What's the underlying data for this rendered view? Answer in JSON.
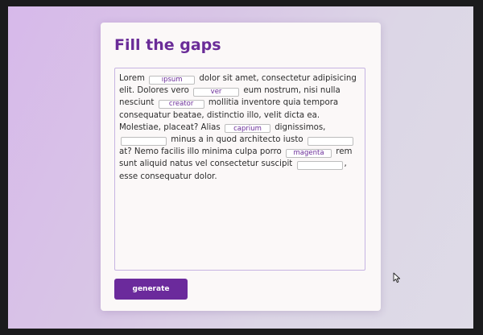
{
  "card": {
    "title": "Fill the gaps"
  },
  "passage": {
    "s1": "Lorem",
    "s2": "dolor sit amet, consectetur adipisicing elit. Dolores vero",
    "s3": "eum nostrum, nisi nulla nesciunt",
    "s4": "mollitia inventore quia tempora consequatur beatae, distinctio illo, velit dicta ea. Molestiae, placeat? Alias",
    "s5": "dignissimos,",
    "s6": "minus a in quod architecto iusto",
    "s7": "at? Nemo facilis illo minima culpa porro",
    "s8": "rem sunt aliquid natus vel consectetur suscipit",
    "s9": ", esse consequatur dolor."
  },
  "gaps": {
    "g1": "ipsum",
    "g2": "ver",
    "g3": "creator",
    "g4": "caprium",
    "g5": "",
    "g6": "",
    "g7": "magenta",
    "g8": ""
  },
  "actions": {
    "generate_label": "generate"
  },
  "icons": {
    "pointer": "mouse-pointer-icon"
  },
  "colors": {
    "accent": "#6b2a9c",
    "title": "#6a2c98",
    "card": "#fbf8f8",
    "textarea_border": "#c6b4e2"
  }
}
